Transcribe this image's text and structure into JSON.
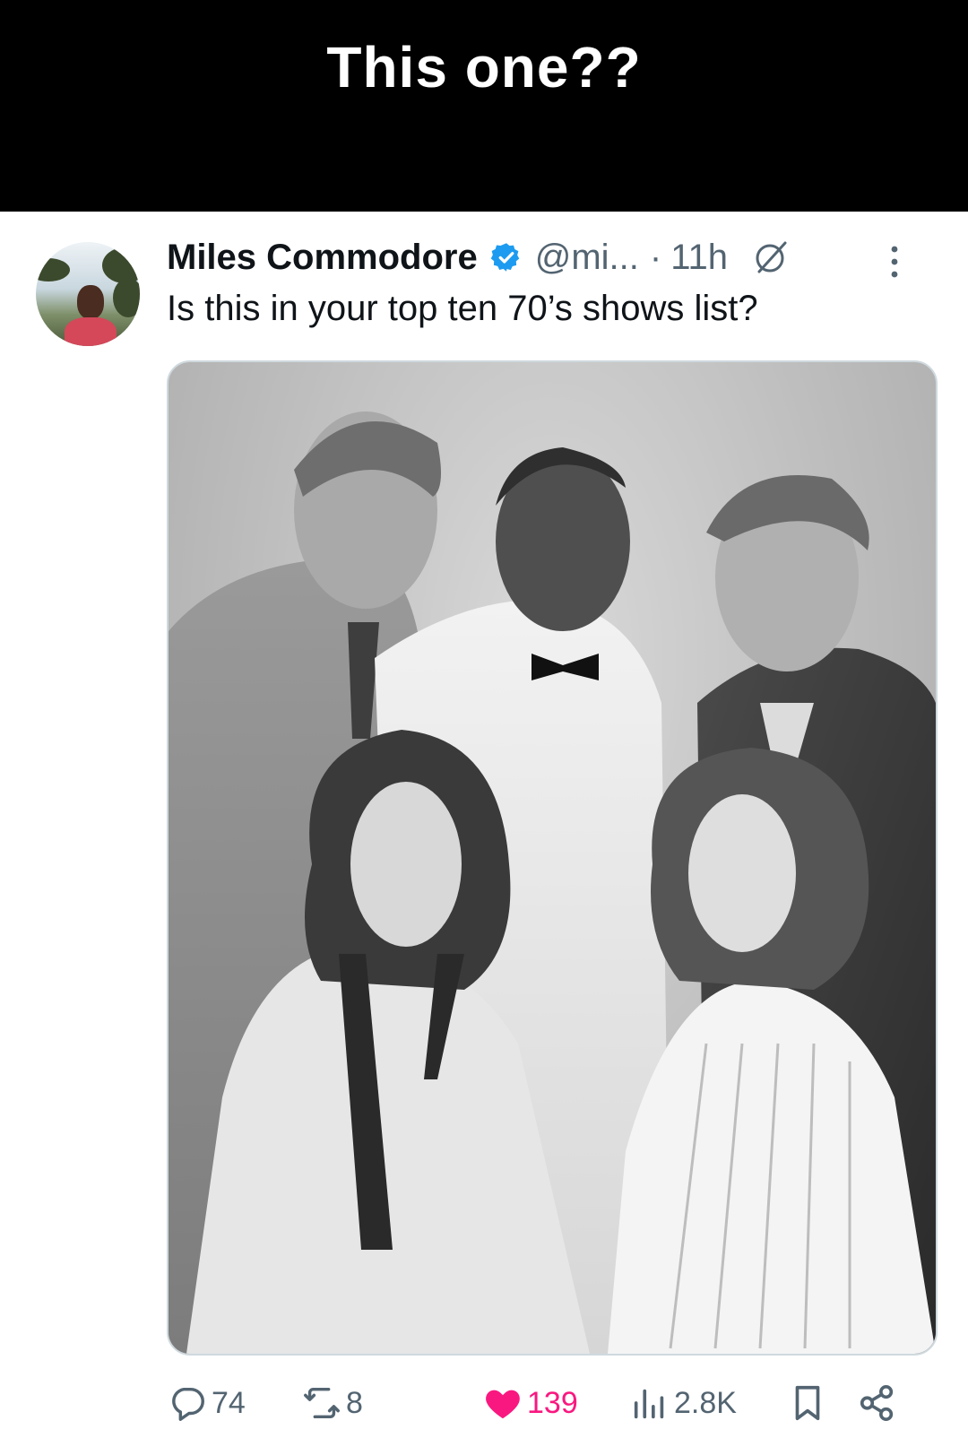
{
  "caption": "This one??",
  "post": {
    "author_name": "Miles Commodore",
    "handle": "@mi...",
    "separator": "·",
    "time": "11h",
    "text": "Is this in your top ten 70’s shows list?",
    "verified": true
  },
  "icons": {
    "verified": "verified-badge-icon",
    "grok": "grok-icon",
    "more": "more-options-icon",
    "reply": "reply-icon",
    "repost": "repost-icon",
    "like": "heart-icon",
    "views": "views-icon",
    "bookmark": "bookmark-icon",
    "share": "share-icon"
  },
  "actions": {
    "replies": "74",
    "reposts": "8",
    "likes": "139",
    "views": "2.8K",
    "liked": true
  },
  "colors": {
    "caption_bg": "#000000",
    "caption_text": "#ffffff",
    "verified": "#1d9bf0",
    "like": "#f91880",
    "secondary_text": "#536471",
    "primary_text": "#0f1419"
  }
}
